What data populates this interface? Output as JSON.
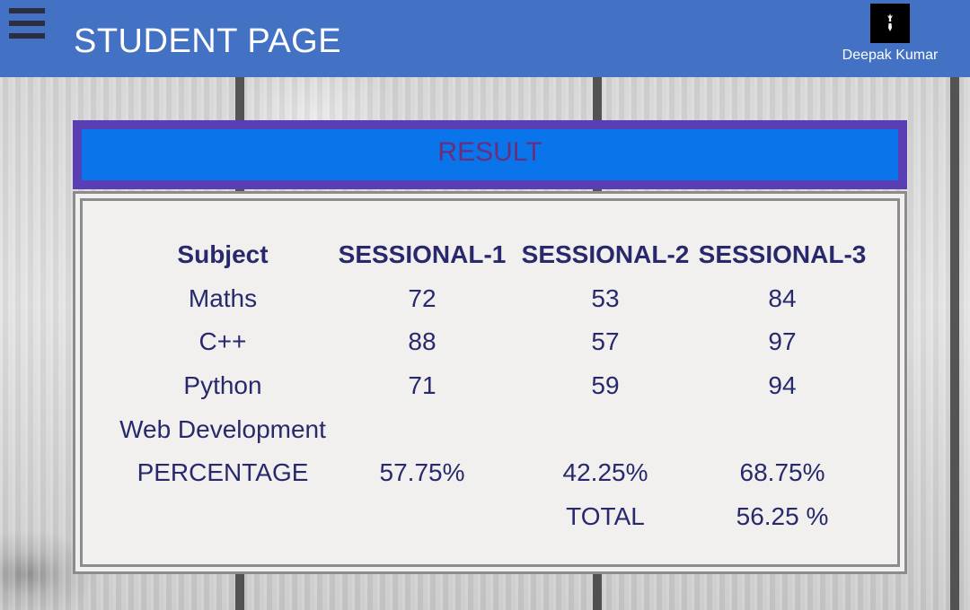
{
  "header": {
    "title": "STUDENT PAGE",
    "menu_icon": "hamburger-menu-icon",
    "user": {
      "name": "Deepak Kumar",
      "avatar_icon": "user-avatar-icon"
    },
    "background_color": "#4372c4"
  },
  "result": {
    "title": "RESULT",
    "columns": [
      "Subject",
      "SESSIONAL-1",
      "SESSIONAL-2",
      "SESSIONAL-3"
    ],
    "rows": [
      {
        "subject": "Maths",
        "s1": "72",
        "s2": "53",
        "s3": "84"
      },
      {
        "subject": "C++",
        "s1": "88",
        "s2": "57",
        "s3": "97"
      },
      {
        "subject": "Python",
        "s1": "71",
        "s2": "59",
        "s3": "94"
      },
      {
        "subject": "Web Development",
        "s1": "",
        "s2": "",
        "s3": ""
      }
    ],
    "percentage": {
      "label": "PERCENTAGE",
      "s1": "57.75%",
      "s2": "42.25%",
      "s3": "68.75%"
    },
    "total": {
      "label": "TOTAL",
      "value": "56.25 %"
    }
  },
  "colors": {
    "banner_fill": "#0a74ea",
    "banner_border": "#5a3fb4",
    "table_text": "#28296c",
    "panel_background": "#f1f0ef"
  }
}
